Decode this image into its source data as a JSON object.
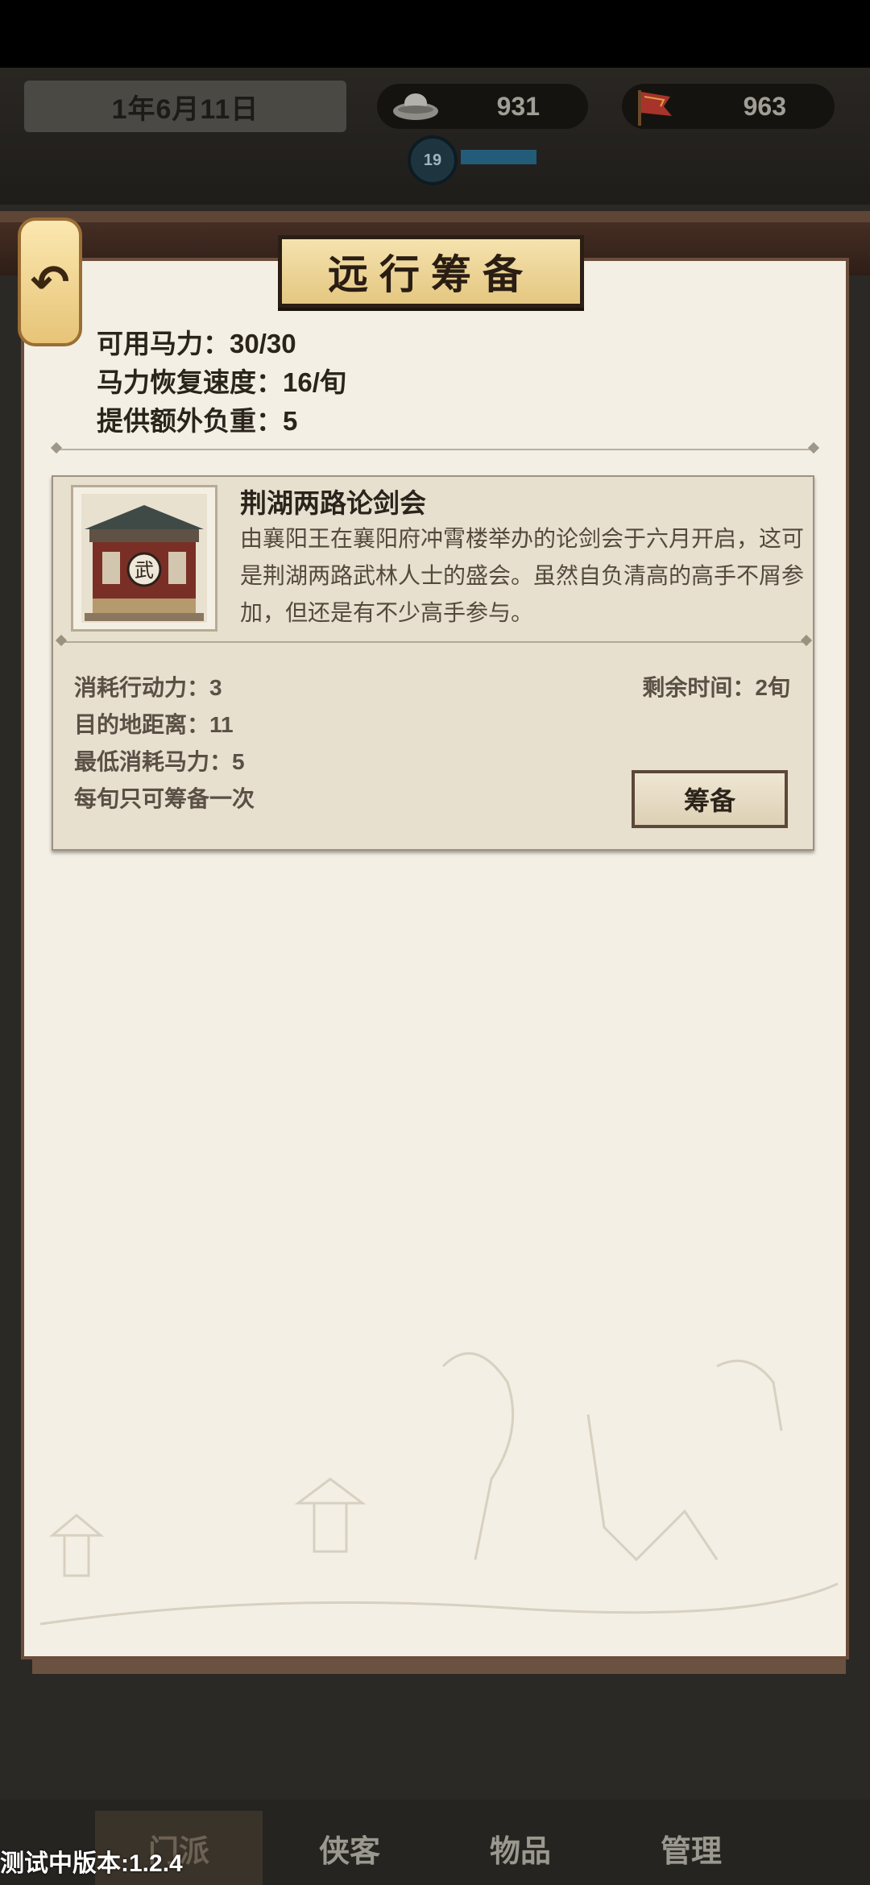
{
  "header": {
    "date": "1年6月11日",
    "silver": "931",
    "flag_count": "963",
    "level": "19",
    "level_progress_pct": 60
  },
  "panel": {
    "title": "远行筹备",
    "back_icon": "back-arrow-icon",
    "stats": {
      "horse_power": "可用马力：30/30",
      "recovery": "马力恢复速度：16/旬",
      "extra_load": "提供额外负重：5"
    }
  },
  "event": {
    "title": "荆湖两路论剑会",
    "description": "由襄阳王在襄阳府冲霄楼举办的论剑会于六月开启，这可是荆湖两路武林人士的盛会。虽然自负清高的高手不屑参加，但还是有不少高手参与。",
    "image_icon": "martial-hall-icon",
    "action_cost": "消耗行动力：3",
    "distance": "目的地距离：11",
    "min_horse": "最低消耗马力：5",
    "limit_note": "每旬只可筹备一次",
    "remaining": "剩余时间：2旬",
    "button_label": "筹备"
  },
  "nav": {
    "items": [
      "门派",
      "侠客",
      "物品",
      "管理"
    ],
    "active_index": 0
  },
  "version": "测试中版本:1.2.4"
}
